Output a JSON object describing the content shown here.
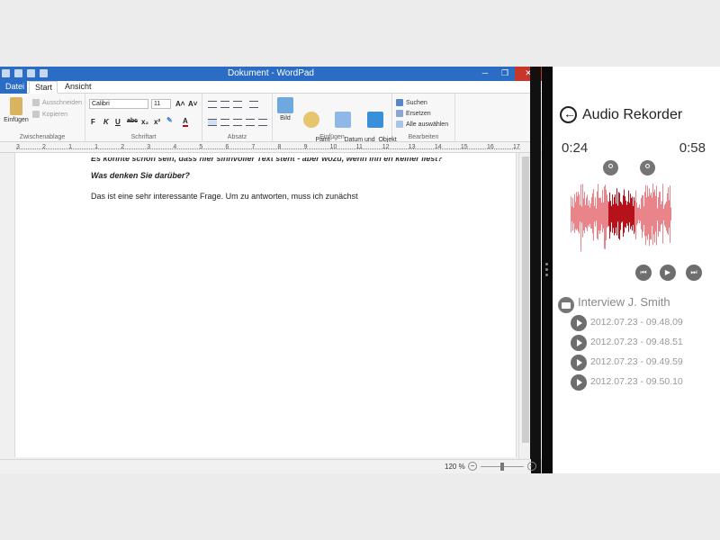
{
  "wordpad": {
    "window_title": "Dokument - WordPad",
    "tabs": [
      "Datei",
      "Start",
      "Ansicht"
    ],
    "clipboard": {
      "paste_label": "Einfügen",
      "cut_label": "Ausschneiden",
      "copy_label": "Kopieren",
      "group_label": "Zwischenablage"
    },
    "font": {
      "family": "Calibri",
      "size": "11",
      "group_label": "Schriftart",
      "buttons": [
        "F",
        "K",
        "U",
        "abc",
        "x₂",
        "x²"
      ]
    },
    "paragraph": {
      "group_label": "Absatz"
    },
    "insert": {
      "items": [
        "Bild",
        "Paint-\nZeichnung",
        "Datum und\nUhrzeit",
        "Objekt\neinfügen"
      ],
      "group_label": "Einfügen"
    },
    "edit": {
      "find_label": "Suchen",
      "replace_label": "Ersetzen",
      "select_all_label": "Alle auswählen",
      "group_label": "Bearbeiten"
    },
    "ruler": [
      "3",
      "2",
      "1",
      "1",
      "2",
      "3",
      "4",
      "5",
      "6",
      "7",
      "8",
      "9",
      "10",
      "11",
      "12",
      "13",
      "14",
      "15",
      "16",
      "17"
    ],
    "document": {
      "cut_line": "Es könnte schon sein, dass hier sinnvoller Text steht - aber wozu, wenn ihn eh keiner liest?",
      "question": "Was denken Sie darüber?",
      "paragraph": "Das ist eine sehr interessante Frage. Um zu antworten, muss ich zunächst"
    },
    "zoom": "120 %",
    "zoom_level_pct": 50
  },
  "recorder": {
    "title": "Audio Rekorder",
    "time_current": "0:24",
    "time_total": "0:58",
    "folder": "Interview J. Smith",
    "recordings": [
      "2012.07.23 - 09.48.09",
      "2012.07.23 - 09.48.51",
      "2012.07.23 - 09.49.59",
      "2012.07.23 - 09.50.10"
    ],
    "colors": {
      "wave_light": "#e9858a",
      "wave_dark": "#b5121b"
    }
  }
}
